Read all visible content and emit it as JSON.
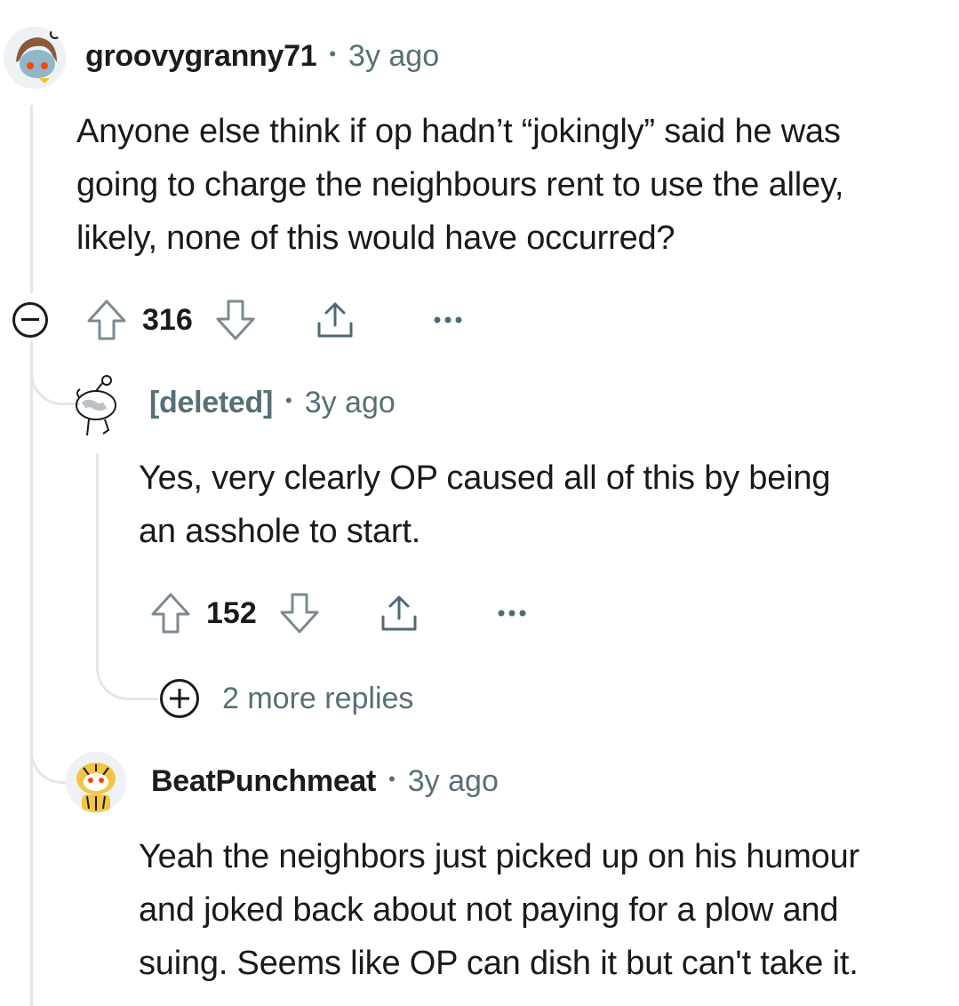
{
  "comments": [
    {
      "author": "groovygranny71",
      "separator": "•",
      "time": "3y ago",
      "body": [
        "Anyone else think if op hadn’t “jokingly” said he was",
        "going to charge the neighbours rent to use the alley,",
        "likely, none of this would have occurred?"
      ],
      "score": "316",
      "avatar_icon": "snoo-avatar-brown-hair"
    },
    {
      "author": "[deleted]",
      "separator": "•",
      "time": "3y ago",
      "body": [
        "Yes, very clearly OP caused all of this by being",
        "an asshole to start."
      ],
      "score": "152",
      "avatar_icon": "deleted-snoo-avatar"
    },
    {
      "author": "BeatPunchmeat",
      "separator": "•",
      "time": "3y ago",
      "body": [
        "Yeah the neighbors just picked up on his humour",
        "and joked back about not paying for a plow and",
        "suing. Seems like OP can dish it but can't take it."
      ],
      "avatar_icon": "snoo-avatar-tiger"
    }
  ],
  "more_replies": "2 more replies",
  "icons": {
    "upvote": "upvote-arrow-icon",
    "downvote": "downvote-arrow-icon",
    "share": "share-icon",
    "overflow": "more-options-icon",
    "collapse": "collapse-minus-icon",
    "expand": "expand-plus-icon"
  },
  "colors": {
    "text": "#1a1a1b",
    "meta": "#576f76",
    "thread": "#e4e6e8"
  }
}
